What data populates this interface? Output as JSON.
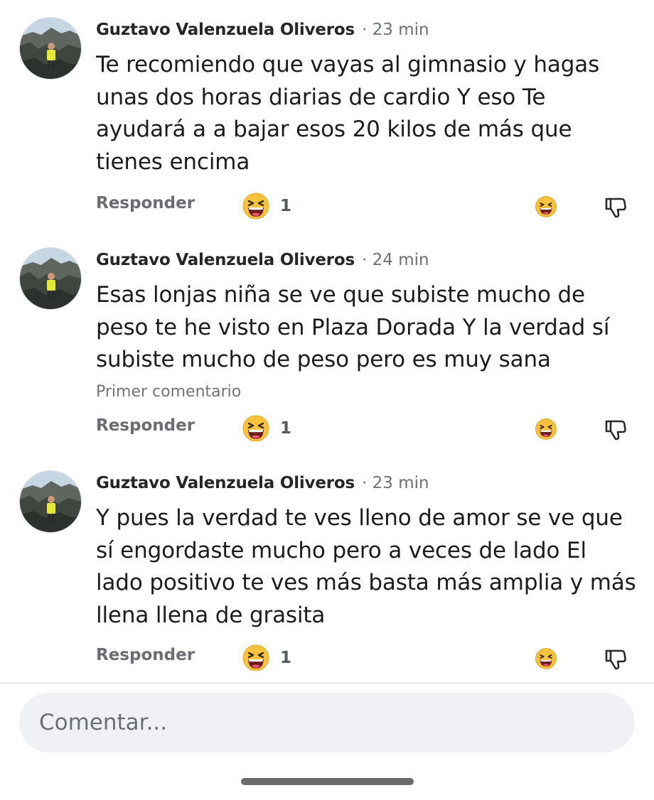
{
  "comments": [
    {
      "author": "Guztavo Valenzuela Oliveros",
      "time": "· 23 min",
      "text": "Te recomiendo que vayas al gimnasio y hagas unas dos horas diarias de cardio Y eso Te ayudará a a bajar esos 20 kilos de más que tienes encima",
      "note": "",
      "reply_label": "Responder",
      "reaction_icon": "grinning-squinting-emoji",
      "reaction_count": "1"
    },
    {
      "author": "Guztavo Valenzuela Oliveros",
      "time": "· 24 min",
      "text": "Esas lonjas niña se ve que subiste mucho de peso te he visto en Plaza Dorada Y la verdad sí subiste mucho de peso pero es muy sana",
      "note": "Primer comentario",
      "reply_label": "Responder",
      "reaction_icon": "grinning-squinting-emoji",
      "reaction_count": "1"
    },
    {
      "author": "Guztavo Valenzuela Oliveros",
      "time": "· 23 min",
      "text": "Y pues la verdad te ves lleno de amor se ve que sí engordaste mucho pero a veces de lado El lado positivo te ves más basta más amplia y más llena llena de grasita",
      "note": "",
      "reply_label": "Responder",
      "reaction_icon": "grinning-squinting-emoji",
      "reaction_count": "1"
    }
  ],
  "composer": {
    "placeholder": "Comentar..."
  },
  "icons": {
    "react_button": "grinning-emoji-outline",
    "dislike_button": "thumbs-down-icon"
  },
  "colors": {
    "emoji_yellow": "#f7c23d",
    "emoji_mouth": "#6b1d1d",
    "text_primary": "#1c1c1c",
    "text_secondary": "#6d7177",
    "composer_bg": "#eff1f4"
  }
}
